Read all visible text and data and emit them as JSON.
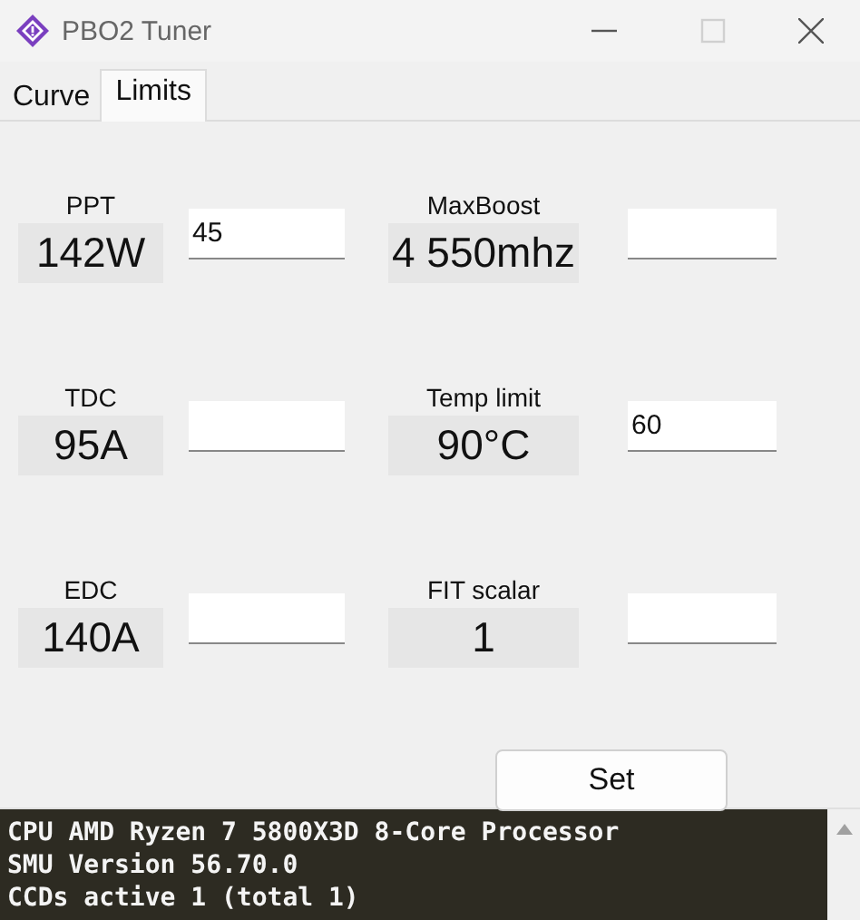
{
  "window": {
    "title": "PBO2 Tuner"
  },
  "tabs": [
    {
      "label": "Curve",
      "selected": false
    },
    {
      "label": "Limits",
      "selected": true
    }
  ],
  "limits": [
    {
      "label": "PPT",
      "reading": "142W",
      "value": "45"
    },
    {
      "label": "MaxBoost",
      "reading": "4 550mhz"
    },
    {
      "label": "TDC",
      "reading": "95A"
    },
    {
      "label": "Temp limit",
      "reading": "90°C",
      "value": "60"
    },
    {
      "label": "EDC",
      "reading": "140A"
    },
    {
      "label": "FIT scalar",
      "reading": "1"
    }
  ],
  "set_button": "Set",
  "console": [
    "CPU AMD Ryzen 7 5800X3D 8-Core Processor",
    "SMU Version 56.70.0",
    "CCDs active 1 (total 1)"
  ]
}
